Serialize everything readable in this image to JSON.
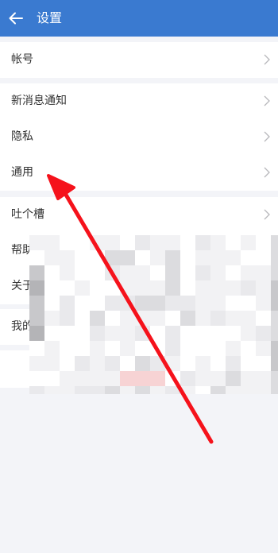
{
  "header": {
    "title": "设置",
    "back_icon": "arrow-left-icon",
    "background_color": "#3a7ad0"
  },
  "sections": [
    {
      "items": [
        {
          "label": "帐号"
        }
      ]
    },
    {
      "items": [
        {
          "label": "新消息通知"
        },
        {
          "label": "隐私"
        },
        {
          "label": "通用"
        }
      ]
    },
    {
      "items": [
        {
          "label": "吐个槽"
        },
        {
          "label": "帮助"
        },
        {
          "label": "关于"
        }
      ]
    },
    {
      "items": [
        {
          "label": "我的"
        }
      ]
    }
  ],
  "annotation": {
    "type": "red-arrow",
    "color": "#f5121b",
    "points_to": "通用"
  },
  "redaction": {
    "type": "pixel-mosaic",
    "colors": [
      "#f2f2f4",
      "#e9e9ec",
      "#dcdcdf",
      "#c8c8cb",
      "#b4b4b7",
      "#f7d3d4",
      "#ffffff"
    ]
  }
}
